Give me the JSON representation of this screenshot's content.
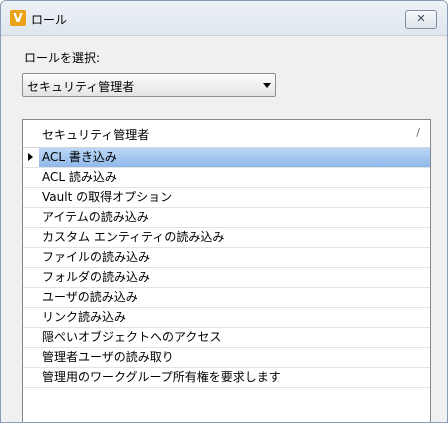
{
  "window": {
    "title": "ロール",
    "app_icon_letter": "V",
    "close_glyph": "✕"
  },
  "role_select": {
    "label": "ロールを選択:",
    "selected": "セキュリティ管理者"
  },
  "permissions_list": {
    "header": "セキュリティ管理者",
    "sort_glyph": "/",
    "selected_index": 0,
    "items": [
      "ACL 書き込み",
      "ACL 読み込み",
      "Vault の取得オプション",
      "アイテムの読み込み",
      "カスタム エンティティの読み込み",
      "ファイルの読み込み",
      "フォルダの読み込み",
      "ユーザの読み込み",
      "リンク読み込み",
      "隠ぺいオブジェクトへのアクセス",
      "管理者ユーザの読み取り",
      "管理用のワークグループ所有権を要求します"
    ]
  }
}
